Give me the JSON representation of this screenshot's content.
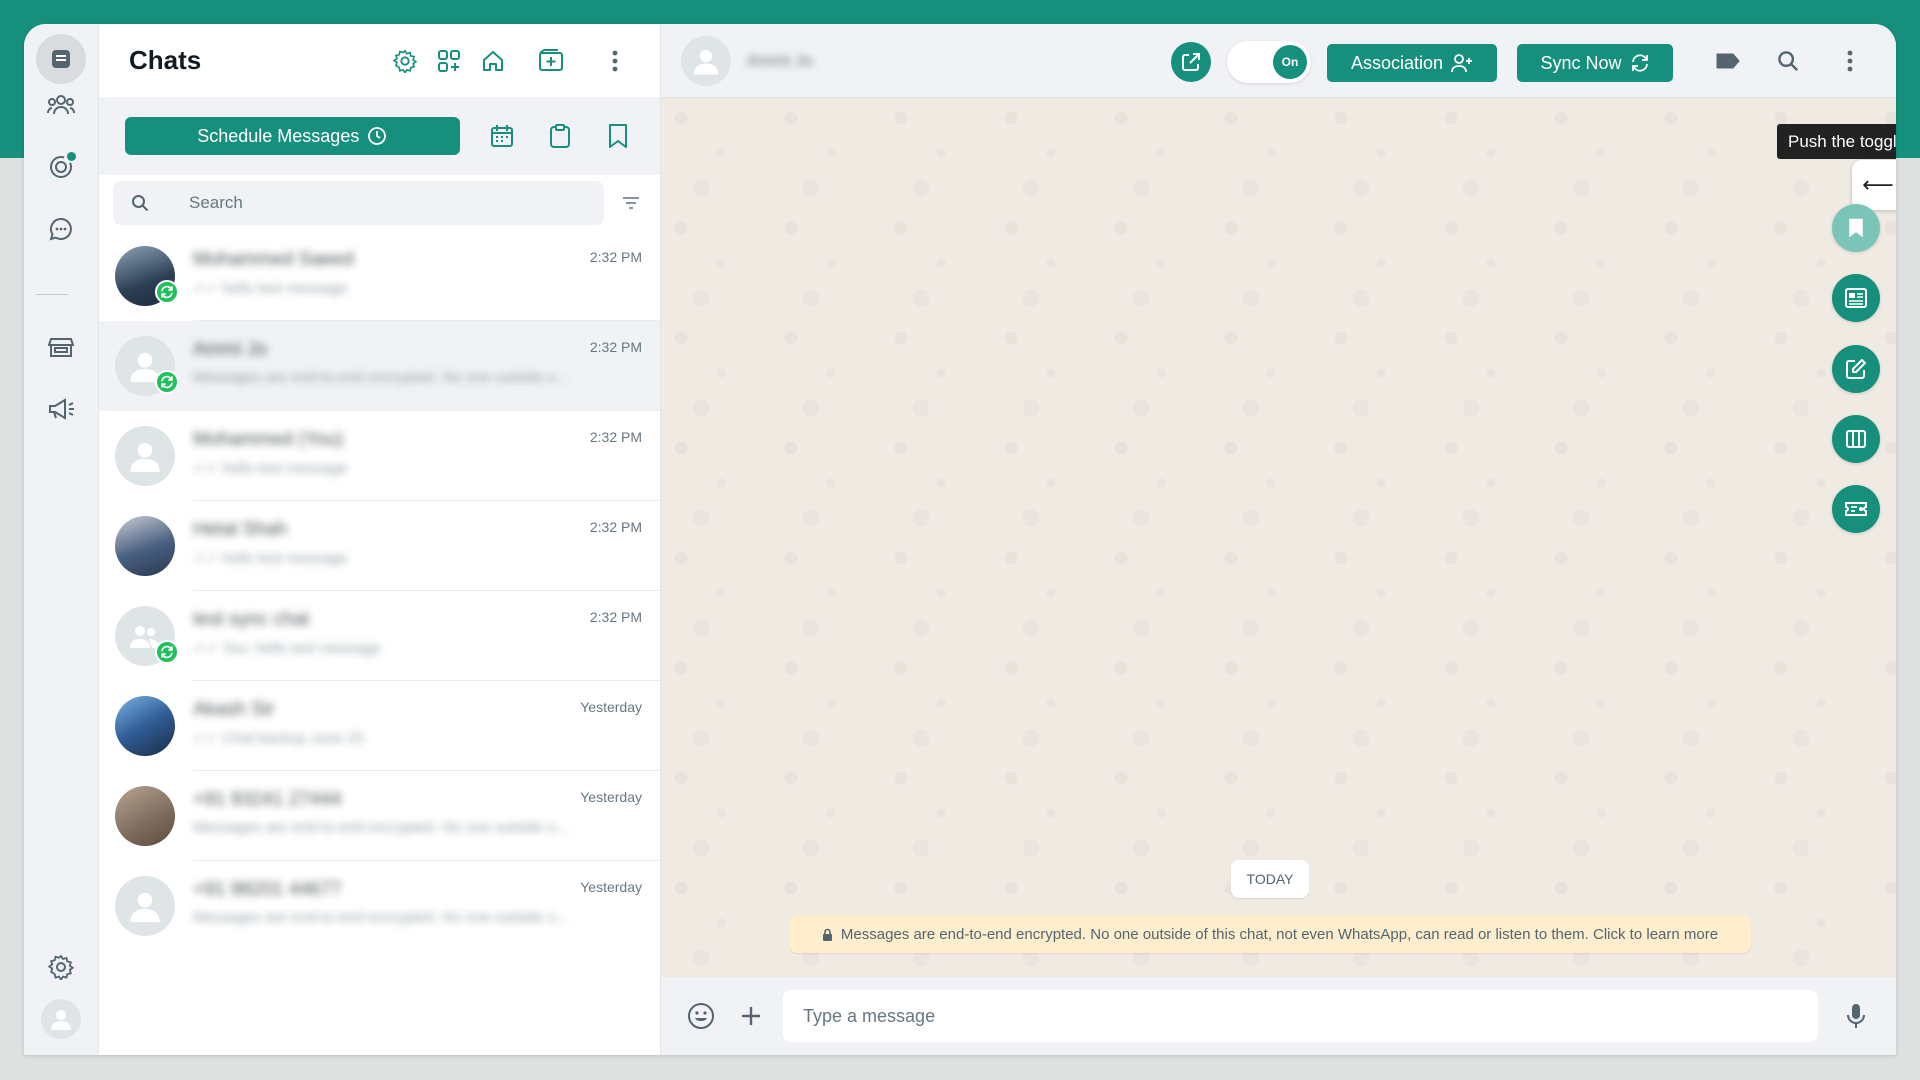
{
  "list": {
    "title": "Chats",
    "schedule_label": "Schedule Messages",
    "search_placeholder": "Search"
  },
  "chats": [
    {
      "name": "Mohammed Saeed",
      "preview": "✓✓ hello test message",
      "time": "2:32 PM",
      "avatar": "photo",
      "sync": true
    },
    {
      "name": "Ammi Jo",
      "preview": "Messages are end-to-end encrypted. No one outside o...",
      "time": "2:32 PM",
      "avatar": "default",
      "sync": true
    },
    {
      "name": "Mohammed (You)",
      "preview": "✓✓ hello test message",
      "time": "2:32 PM",
      "avatar": "default",
      "sync": false
    },
    {
      "name": "Hetal Shah",
      "preview": "✓✓ hello test message",
      "time": "2:32 PM",
      "avatar": "photo",
      "sync": false
    },
    {
      "name": "test sync chat",
      "preview": "✓✓ You: hello test message",
      "time": "2:32 PM",
      "avatar": "group",
      "sync": true
    },
    {
      "name": "Akash Sir",
      "preview": "✓✓ Chat backup June 25",
      "time": "Yesterday",
      "avatar": "photo",
      "sync": false
    },
    {
      "name": "+91 93241 27444",
      "preview": "Messages are end-to-end encrypted. No one outside o...",
      "time": "Yesterday",
      "avatar": "photo",
      "sync": false
    },
    {
      "name": "+91 98201 44677",
      "preview": "Messages are end-to-end encrypted. No one outside o...",
      "time": "Yesterday",
      "avatar": "default",
      "sync": false
    }
  ],
  "conversation": {
    "contact_name": "Ammi Jo",
    "toggle_label": "On",
    "association_label": "Association",
    "sync_label": "Sync Now",
    "tooltip": "Push the toggle to Sync all Messages",
    "date_chip": "TODAY",
    "e2e_notice": "Messages are end-to-end encrypted. No one outside of this chat, not even WhatsApp, can read or listen to them. Click to learn more",
    "input_placeholder": "Type a message",
    "side_tab_arrow": "⟵"
  },
  "colors": {
    "brand": "#16907d",
    "panel": "#f0f2f5",
    "wallpaper": "#efeae2",
    "notice": "#ffeecd",
    "sync_badge": "#20c05c"
  }
}
